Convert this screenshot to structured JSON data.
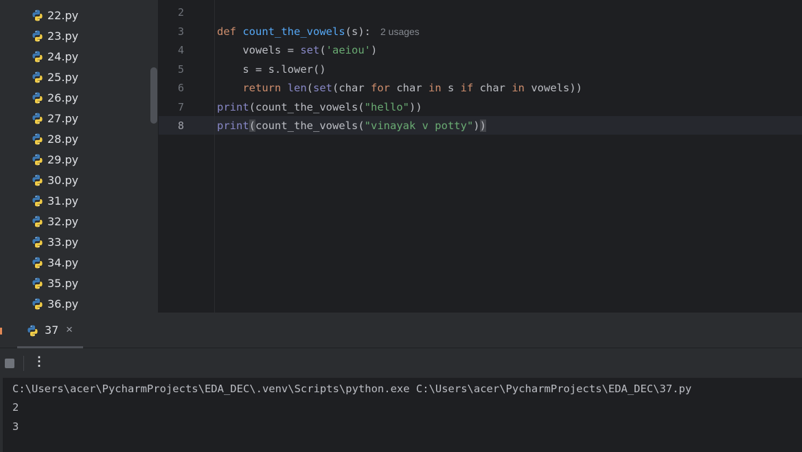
{
  "project_tree": {
    "items": [
      "22.py",
      "23.py",
      "24.py",
      "25.py",
      "26.py",
      "27.py",
      "28.py",
      "29.py",
      "30.py",
      "31.py",
      "32.py",
      "33.py",
      "34.py",
      "35.py",
      "36.py"
    ]
  },
  "editor": {
    "line_numbers": [
      "2",
      "3",
      "4",
      "5",
      "6",
      "7",
      "8"
    ],
    "code": {
      "l3_def": "def",
      "l3_name": "count_the_vowels",
      "l3_params": "(s):",
      "l3_hint": "2 usages",
      "l4_a": "    vowels = ",
      "l4_set": "set",
      "l4_b": "(",
      "l4_str": "'aeiou'",
      "l4_c": ")",
      "l5": "    s = s.lower()",
      "l6_return": "    return",
      "l6_len": " len",
      "l6_a": "(",
      "l6_set": "set",
      "l6_b": "(char ",
      "l6_for": "for",
      "l6_c": " char ",
      "l6_in1": "in",
      "l6_d": " s ",
      "l6_if": "if",
      "l6_e": " char ",
      "l6_in2": "in",
      "l6_f": " vowels))",
      "l7_print": "print",
      "l7_a": "(count_the_vowels(",
      "l7_str": "\"hello\"",
      "l7_b": "))",
      "l8_print": "print",
      "l8_open": "(",
      "l8_a": "count_the_vowels(",
      "l8_str": "\"vinayak v potty\"",
      "l8_b": ")",
      "l8_close": ")"
    }
  },
  "run_panel": {
    "tab_label": "37",
    "tab_close": "×",
    "more_glyph": "⋮",
    "console_lines": [
      "C:\\Users\\acer\\PycharmProjects\\EDA_DEC\\.venv\\Scripts\\python.exe C:\\Users\\acer\\PycharmProjects\\EDA_DEC\\37.py",
      "2",
      "3"
    ]
  },
  "icons": {
    "file_icon": "python-file-icon",
    "stop": "stop-icon",
    "more": "more-vertical-icon",
    "close": "close-icon"
  },
  "colors": {
    "keyword": "#cf8e6d",
    "function": "#56a8f5",
    "builtin": "#8888c6",
    "string": "#6aab73",
    "python_blue": "#3d7ab5",
    "python_yellow": "#f2cd47"
  }
}
